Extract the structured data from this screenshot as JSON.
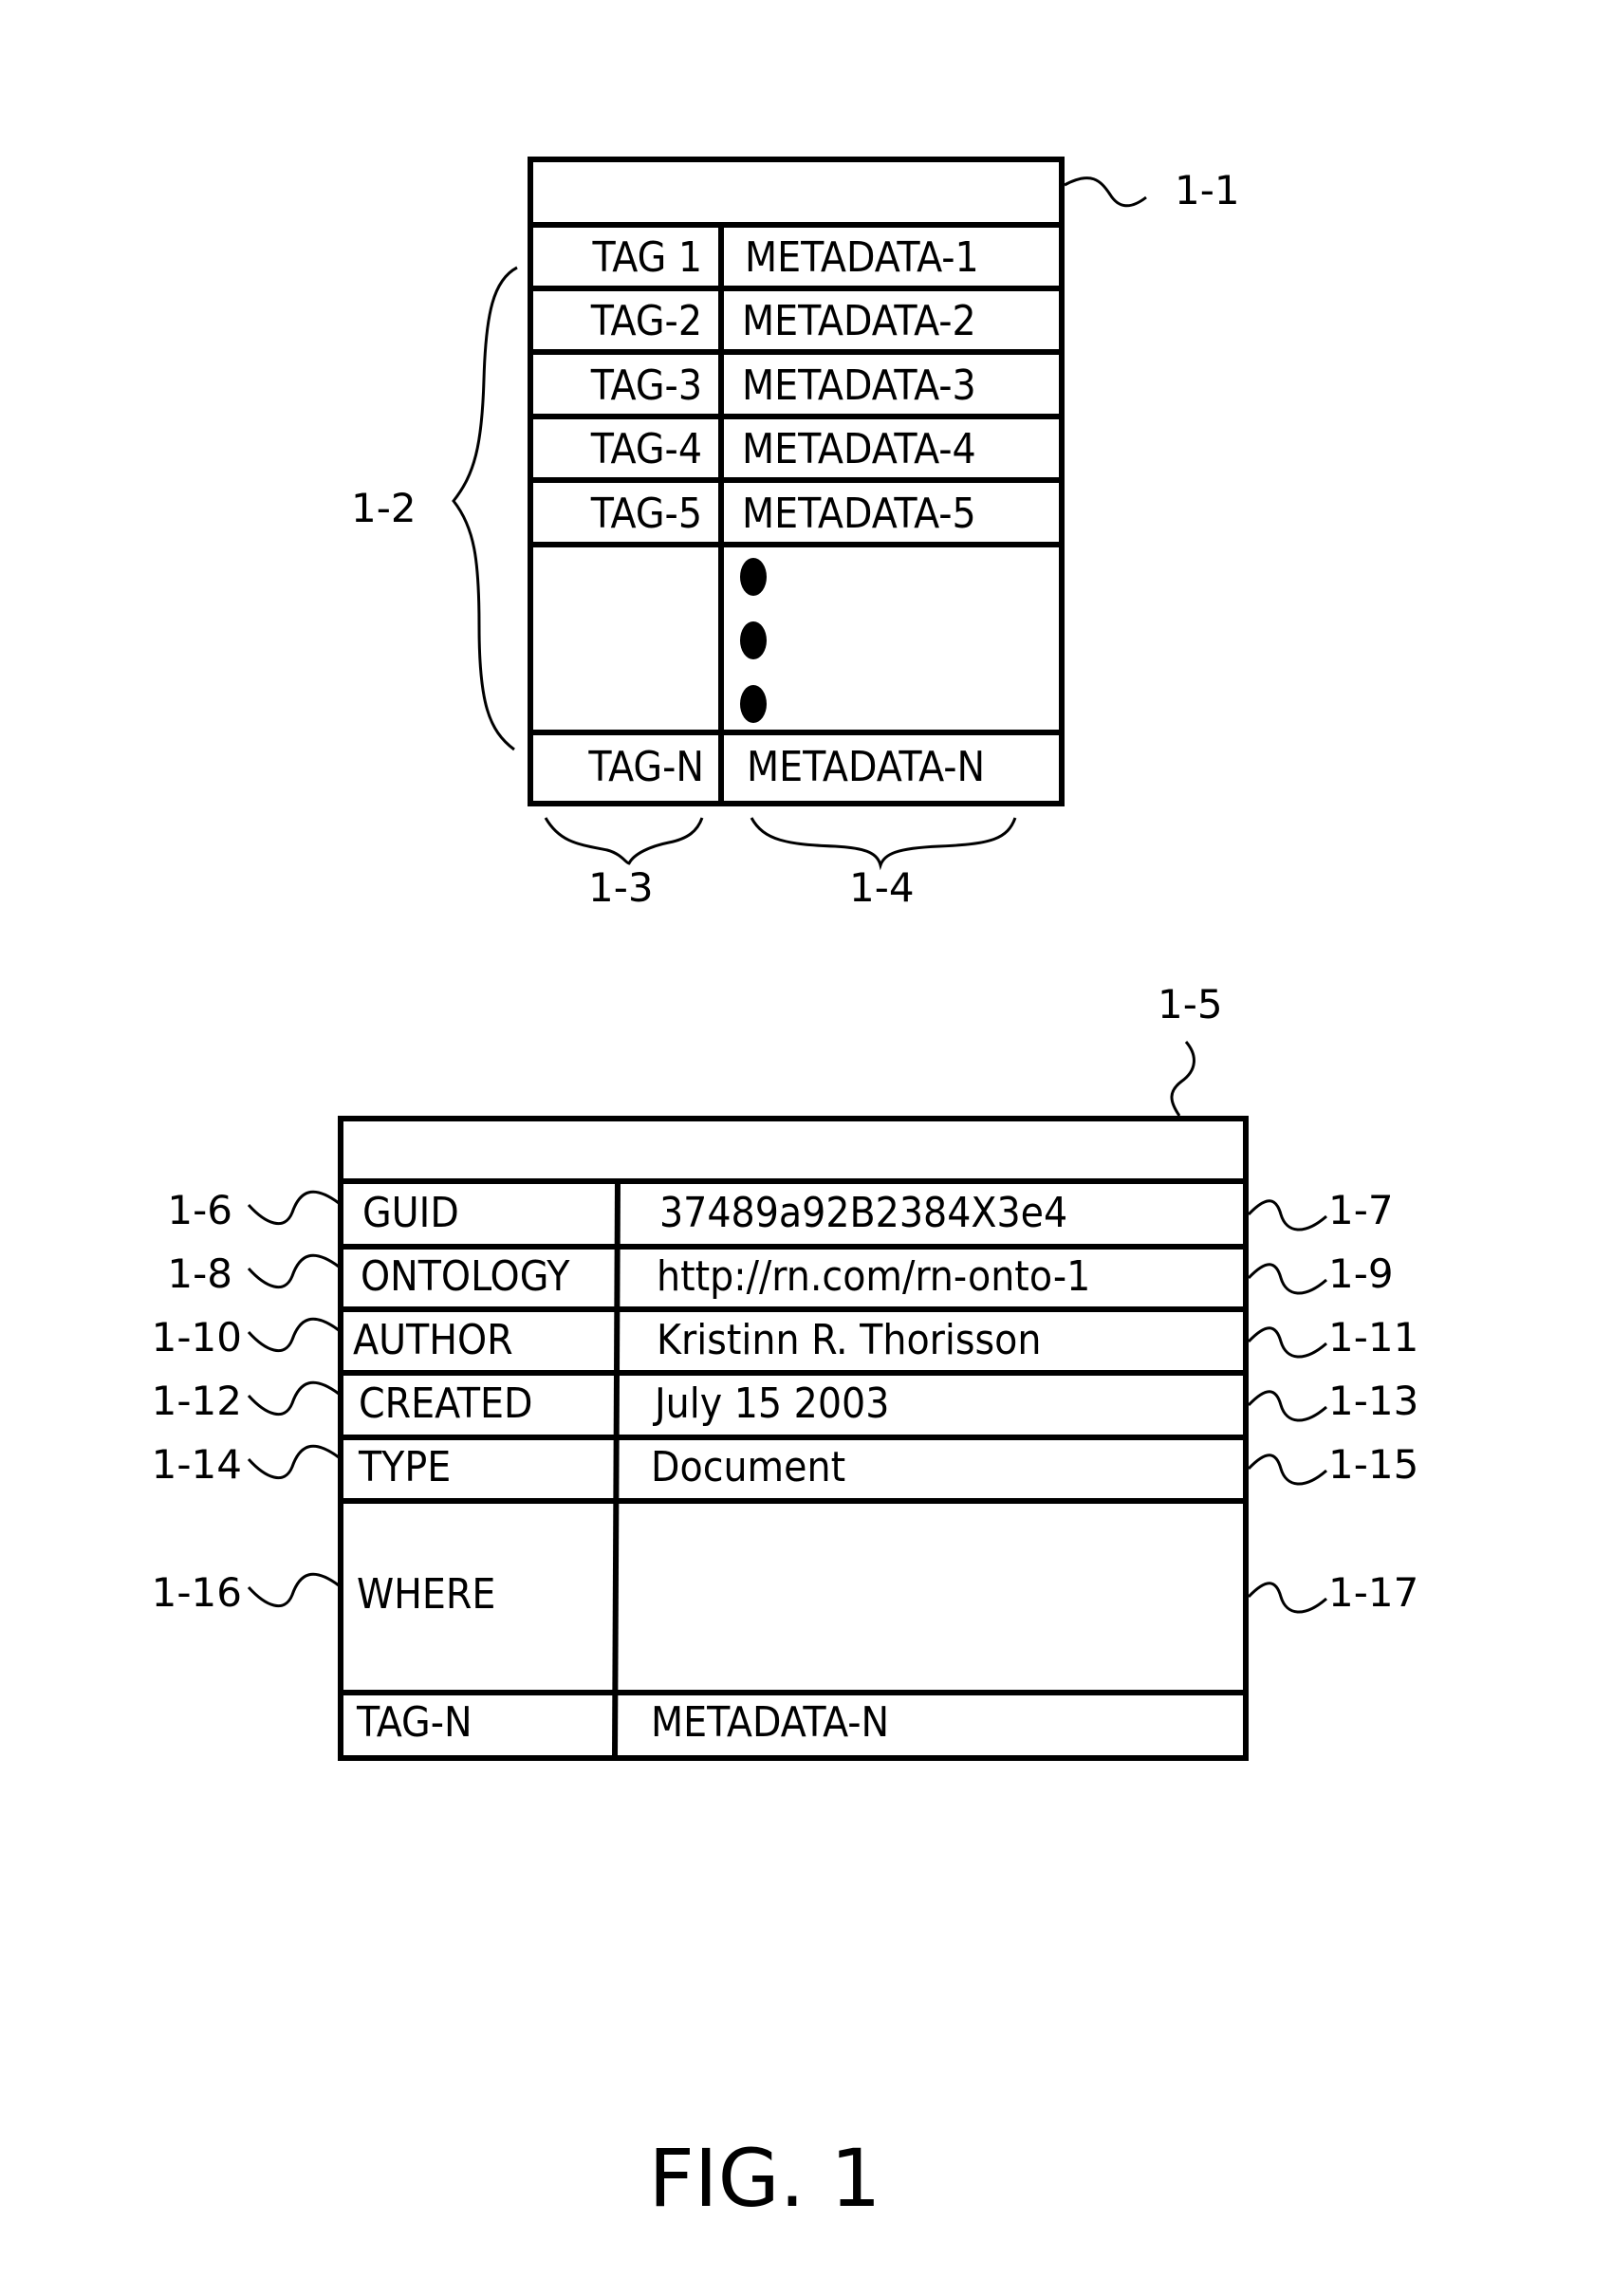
{
  "figure": {
    "caption": "FIG. 1",
    "top_table": {
      "ref_table": "1-1",
      "ref_rows": "1-2",
      "ref_tag_column": "1-3",
      "ref_metadata_column": "1-4",
      "rows": [
        {
          "tag": "TAG 1",
          "value": "METADATA-1"
        },
        {
          "tag": "TAG-2",
          "value": "METADATA-2"
        },
        {
          "tag": "TAG-3",
          "value": "METADATA-3"
        },
        {
          "tag": "TAG-4",
          "value": "METADATA-4"
        },
        {
          "tag": "TAG-5",
          "value": "METADATA-5"
        }
      ],
      "ellipsis": "vertical-ellipsis-dots",
      "last_row": {
        "tag": "TAG-N",
        "value": "METADATA-N"
      }
    },
    "bottom_table": {
      "ref_table": "1-5",
      "rows": [
        {
          "ref_left": "1-6",
          "tag": "GUID",
          "value": "37489a92B2384X3e4",
          "ref_right": "1-7"
        },
        {
          "ref_left": "1-8",
          "tag": "ONTOLOGY",
          "value": "http://rn.com/rn-onto-1",
          "ref_right": "1-9"
        },
        {
          "ref_left": "1-10",
          "tag": "AUTHOR",
          "value": "Kristinn R. Thorisson",
          "ref_right": "1-11"
        },
        {
          "ref_left": "1-12",
          "tag": "CREATED",
          "value": "July 15 2003",
          "ref_right": "1-13"
        },
        {
          "ref_left": "1-14",
          "tag": "TYPE",
          "value": "Document",
          "ref_right": "1-15"
        },
        {
          "ref_left": "1-16",
          "tag": "WHERE",
          "value": "",
          "ref_right": "1-17"
        }
      ],
      "last_row": {
        "tag": "TAG-N",
        "value": "METADATA-N"
      }
    }
  }
}
